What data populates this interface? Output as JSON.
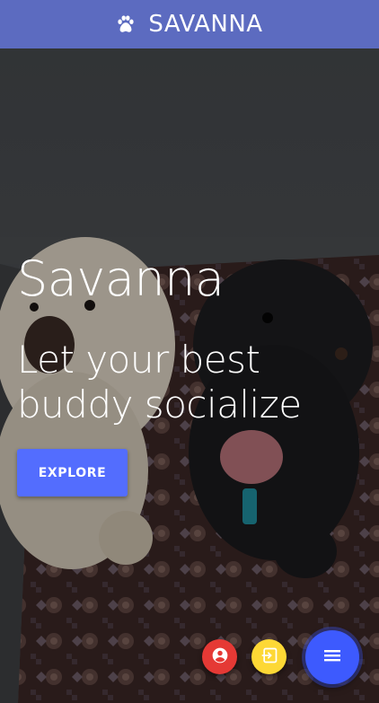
{
  "app": {
    "title": "SAVANNA",
    "logo_icon": "paw-icon"
  },
  "hero": {
    "name": "Savanna",
    "tagline": "Let your best buddy socialize",
    "explore_label": "EXPLORE",
    "image_subject": "two dogs on a patterned rug"
  },
  "fabs": {
    "profile_icon": "account-circle-icon",
    "login_icon": "login-icon",
    "menu_icon": "menu-icon"
  },
  "colors": {
    "header": "#5c6bc0",
    "explore_button": "#536dfe",
    "fab_profile": "#e53935",
    "fab_login": "#fdd835",
    "fab_menu": "#3d5afe"
  }
}
